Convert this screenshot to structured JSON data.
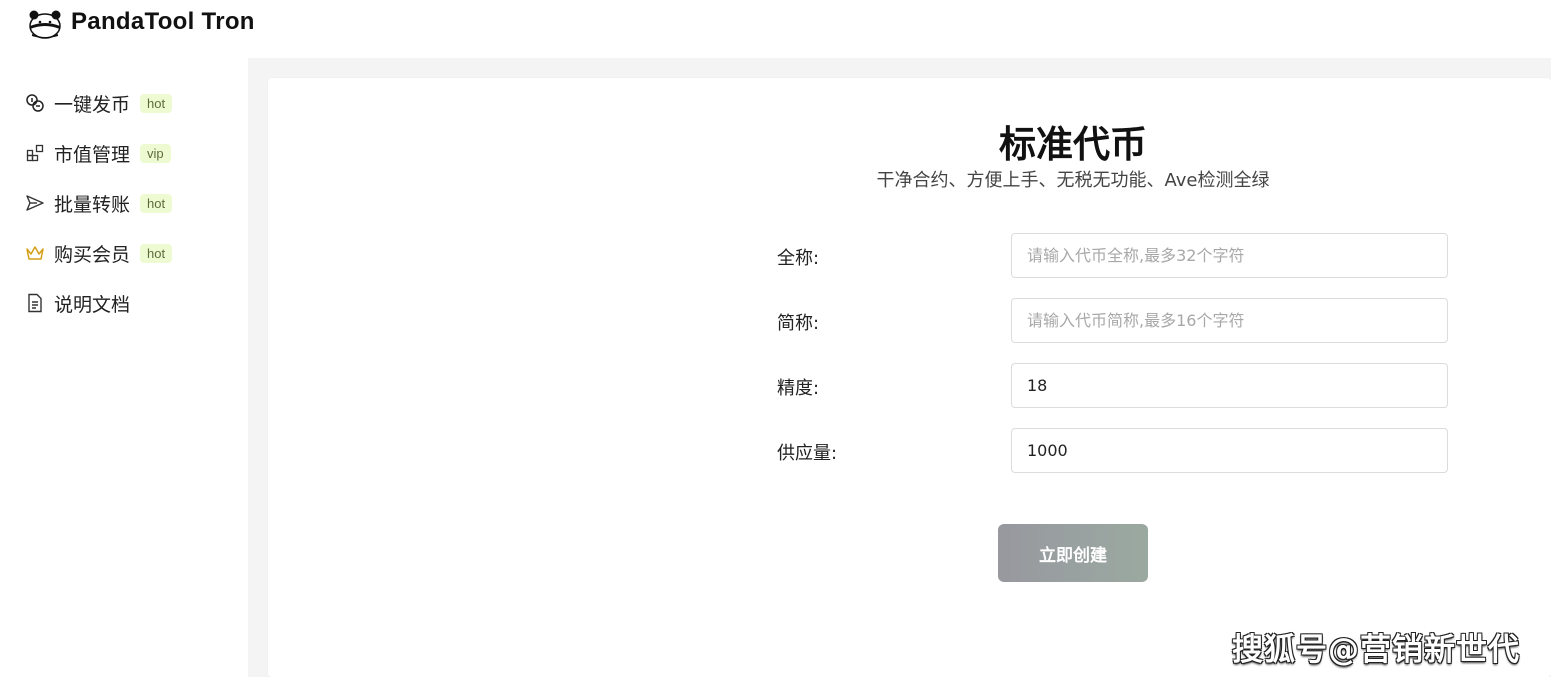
{
  "app": {
    "brand": "PandaTool Tron"
  },
  "sidebar": {
    "items": [
      {
        "label": "一键发币",
        "badge": "hot",
        "icon": "coins-icon"
      },
      {
        "label": "市值管理",
        "badge": "vip",
        "icon": "apps-icon"
      },
      {
        "label": "批量转账",
        "badge": "hot",
        "icon": "send-icon"
      },
      {
        "label": "购买会员",
        "badge": "hot",
        "icon": "crown-icon"
      },
      {
        "label": "说明文档",
        "badge": "",
        "icon": "document-icon"
      }
    ]
  },
  "main": {
    "title": "标准代币",
    "subtitle": "干净合约、方便上手、无税无功能、Ave检测全绿",
    "fields": [
      {
        "label": "全称:",
        "value": "",
        "placeholder": "请输入代币全称,最多32个字符"
      },
      {
        "label": "简称:",
        "value": "",
        "placeholder": "请输入代币简称,最多16个字符"
      },
      {
        "label": "精度:",
        "value": "18",
        "placeholder": ""
      },
      {
        "label": "供应量:",
        "value": "1000",
        "placeholder": ""
      }
    ],
    "submit_label": "立即创建"
  },
  "watermark": "搜狐号@营销新世代",
  "colors": {
    "badge_bg": "#eefbd2",
    "crown_icon": "#d4a017",
    "button_gradient_start": "#98989f",
    "button_gradient_end": "#9aa9a0",
    "content_bg": "#f4f4f4"
  }
}
